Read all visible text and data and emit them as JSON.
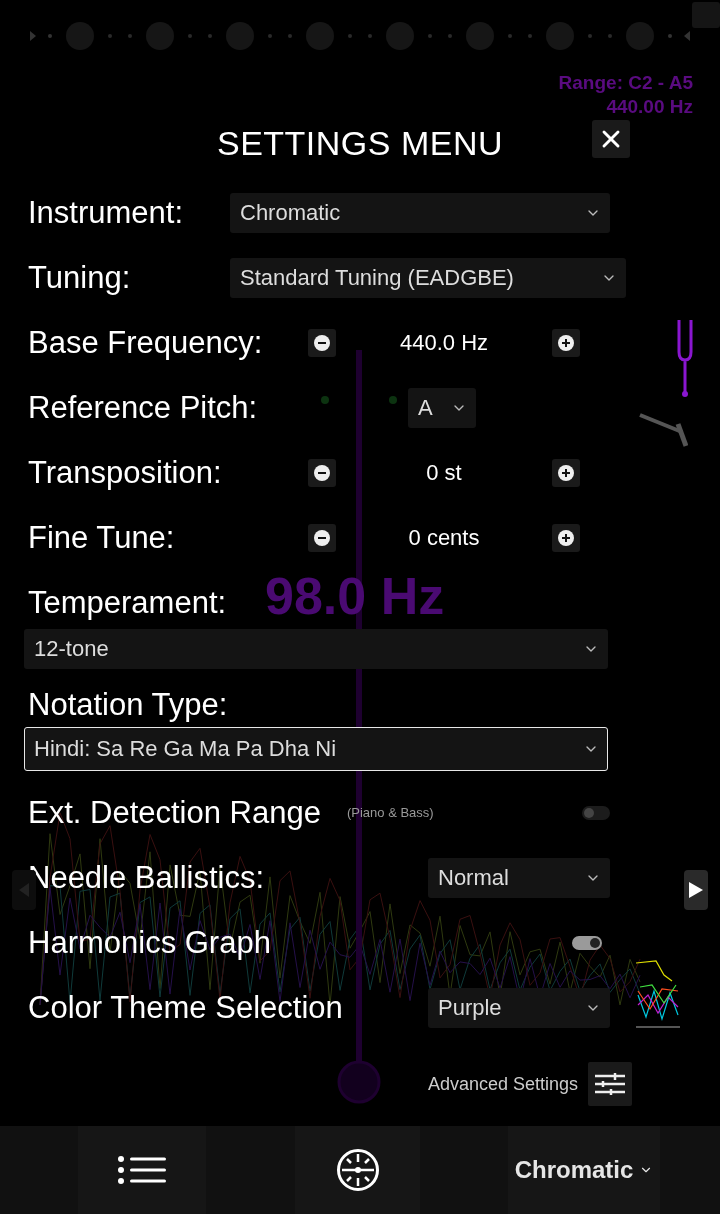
{
  "background": {
    "range": "Range: C2 - A5",
    "frequency": "440.00 Hz",
    "big_reading": "98.0 Hz"
  },
  "settings": {
    "title": "SETTINGS MENU",
    "rows": [
      {
        "kind": "select",
        "label": "Instrument:",
        "value": "Chromatic"
      },
      {
        "kind": "select",
        "label": "Tuning:",
        "value": "Standard Tuning (EADGBE)"
      },
      {
        "kind": "stepper",
        "label": "Base Frequency:",
        "value": "440.0 Hz"
      },
      {
        "kind": "short-select",
        "label": "Reference Pitch:",
        "value": "A"
      },
      {
        "kind": "stepper",
        "label": "Transposition:",
        "value": "0 st"
      },
      {
        "kind": "stepper",
        "label": "Fine Tune:",
        "value": "0 cents"
      },
      {
        "kind": "wide-select",
        "label": "Temperament:",
        "value": "12-tone",
        "focused": false
      },
      {
        "kind": "wide-select",
        "label": "Notation Type:",
        "value": "Hindi: Sa Re Ga Ma Pa Dha Ni",
        "focused": true
      },
      {
        "kind": "toggle",
        "label": "Ext. Detection Range",
        "note": "(Piano & Bass)",
        "on": false
      },
      {
        "kind": "side-select",
        "label": "Needle Ballistics:",
        "value": "Normal"
      },
      {
        "kind": "toggle",
        "label": "Harmonics Graph",
        "on": true
      },
      {
        "kind": "side-select",
        "label": "Color Theme Selection",
        "value": "Purple"
      }
    ],
    "advanced": "Advanced Settings"
  },
  "bottom_bar": {
    "mode": "Chromatic"
  }
}
